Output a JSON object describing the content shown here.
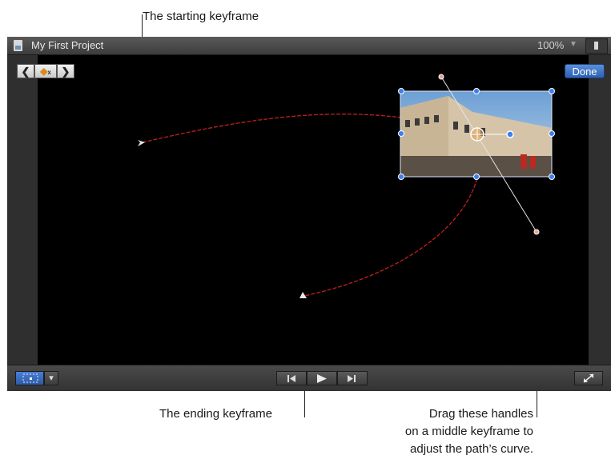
{
  "callouts": {
    "start": "The starting keyframe",
    "end": "The ending keyframe",
    "handles_line1": "Drag these handles",
    "handles_line2": "on a middle keyframe to",
    "handles_line3": "adjust the path’s curve."
  },
  "viewer": {
    "title": "My First Project",
    "zoom": "100%",
    "done_label": "Done"
  },
  "icons": {
    "prev_keyframe": "chevron-left-icon",
    "keyframe": "keyframe-diamond-icon",
    "next_keyframe": "chevron-right-icon",
    "transform": "transform-tool-icon",
    "play": "play-icon",
    "skip_back": "skip-back-icon",
    "skip_forward": "skip-forward-icon",
    "fullscreen": "fullscreen-icon"
  },
  "colors": {
    "motion_path": "#c0211a",
    "handle_blue": "#3b7ff2",
    "done_blue": "#2c60b4"
  }
}
